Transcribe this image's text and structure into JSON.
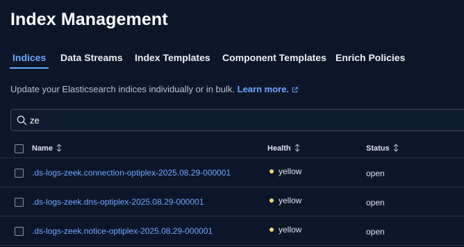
{
  "page": {
    "title": "Index Management"
  },
  "tabs": [
    {
      "label": "Indices",
      "selected": true
    },
    {
      "label": "Data Streams",
      "selected": false
    },
    {
      "label": "Index Templates",
      "selected": false
    },
    {
      "label": "Component Templates",
      "selected": false
    },
    {
      "label": "Enrich Policies",
      "selected": false
    }
  ],
  "description": {
    "text": "Update your Elasticsearch indices individually or in bulk.",
    "link_label": "Learn more.",
    "link_icon": "external-link-icon"
  },
  "search": {
    "value": "ze",
    "icon": "search-icon"
  },
  "table": {
    "columns": [
      {
        "label": "Name",
        "sort_icon": "sort-icon"
      },
      {
        "label": "Health",
        "sort_icon": "sort-icon"
      },
      {
        "label": "Status",
        "sort_icon": "sort-icon"
      }
    ],
    "rows": [
      {
        "name": ".ds-logs-zeek.connection-optiplex-2025.08.29-000001",
        "health": "yellow",
        "status": "open"
      },
      {
        "name": ".ds-logs-zeek.dns-optiplex-2025.08.29-000001",
        "health": "yellow",
        "status": "open"
      },
      {
        "name": ".ds-logs-zeek.notice-optiplex-2025.08.29-000001",
        "health": "yellow",
        "status": "open"
      }
    ]
  },
  "colors": {
    "background": "#0b1628",
    "accent": "#6ea8ff",
    "health_yellow": "#f1d86f"
  }
}
